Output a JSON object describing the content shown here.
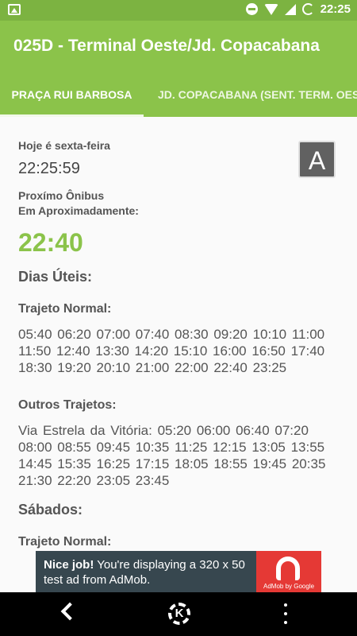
{
  "status_bar": {
    "time": "22:25",
    "icons": [
      "image-icon",
      "dnd-icon",
      "wifi-icon",
      "signal-icon",
      "sync-icon"
    ]
  },
  "app_bar": {
    "title": "025D - Terminal Oeste/Jd. Copacabana",
    "color": "#8bc34a"
  },
  "tabs": [
    {
      "label": "PRAÇA RUI BARBOSA",
      "active": true
    },
    {
      "label": "JD. COPACABANA (SENT. TERM. OES",
      "active": false
    }
  ],
  "info": {
    "day_text": "Hoje é sexta-feira",
    "clock": "22:25:59",
    "next_label_1": "Proxímo Ônibus",
    "next_label_2": "Em Aproximadamente:",
    "next_time": "22:40",
    "a_button": "A"
  },
  "schedule": {
    "weekdays_title": "Dias Úteis:",
    "normal_route_title": "Trajeto Normal:",
    "normal_times": "05:40 06:20 07:00 07:40 08:30 09:20 10:10 11:00 11:50 12:40 13:30 14:20 15:10 16:00 16:50 17:40 18:30 19:20 20:10 21:00 22:00 22:40 23:25",
    "other_routes_title": "Outros Trajetos:",
    "other_times": "Via Estrela da Vitória: 05:20 06:00 06:40 07:20 08:00 08:55 09:45 10:35 11:25 12:15 13:05 13:55 14:45 15:35 16:25 17:15 18:05 18:55 19:45 20:35 21:30 22:20 23:05 23:45",
    "saturday_title": "Sábados:",
    "saturday_normal_title": "Trajeto Normal:"
  },
  "ad": {
    "bold": "Nice job!",
    "text": " You're displaying a 320 x 50 test ad from AdMob.",
    "brand": "AdMob by Google"
  },
  "nav_bar": {
    "home_glyph": "K",
    "icons": [
      "back-icon",
      "home-icon",
      "menu-dots-icon"
    ]
  }
}
